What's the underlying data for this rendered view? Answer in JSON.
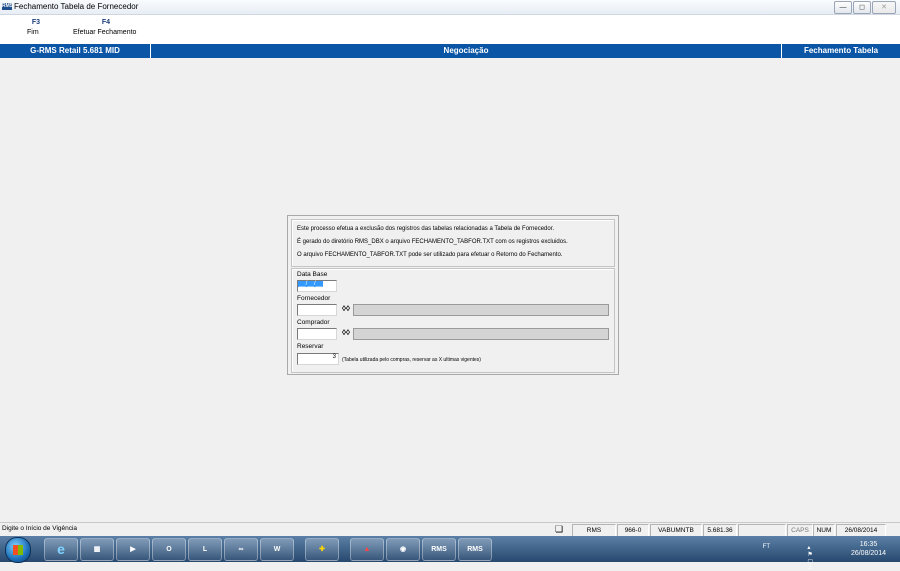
{
  "window": {
    "title": "Fechamento Tabela de Fornecedor",
    "app_icon": "RMS"
  },
  "fkeys": [
    {
      "code": "F3",
      "label": "Fim"
    },
    {
      "code": "F4",
      "label": "Efetuar Fechamento"
    }
  ],
  "infobar": {
    "system": "G-RMS Retail 5.681 MID",
    "module": "Negociação",
    "function": "Fechamento Tabela"
  },
  "dialog": {
    "info_lines": [
      "Este processo efetua a exclusão dos registros das tabelas relacionadas a Tabela de Fornecedor.",
      "É gerado do diretório RMS_DBX o arquivo FECHAMENTO_TABFOR.TXT com os registros excluidos.",
      "O arquivo FECHAMENTO_TABFOR.TXT pode ser utilizado para efetuar o Retorno do Fechamento."
    ],
    "data_base_label": "Data Base",
    "data_base_value": "__/__/__",
    "fornecedor_label": "Fornecedor",
    "fornecedor_value": "",
    "comprador_label": "Comprador",
    "comprador_value": "",
    "reservar_label": "Reservar",
    "reservar_value": "3",
    "reservar_note": "(Tabela utilizada pelo compras, reservar as X ultimas vigentes)"
  },
  "statusbar": {
    "message": "Digite o Início de Vigência",
    "cells": [
      "RMS",
      "966-0",
      "VABUMNTB",
      "5.681.36",
      "",
      "CAPS",
      "NUM",
      "26/08/2014"
    ]
  },
  "taskbar": {
    "apps": [
      "ie-icon",
      "explorer-icon",
      "media-icon",
      "outlook-icon",
      "lync-icon",
      "app-icon",
      "word-icon",
      "install-icon",
      "pdf-icon",
      "network-icon",
      "RMS",
      "RMS"
    ],
    "tray_lang": "FT",
    "time": "16:35",
    "date": "26/08/2014"
  },
  "colors": {
    "infobar": "#0a55a5",
    "fkey_code": "#1a3d7c"
  }
}
